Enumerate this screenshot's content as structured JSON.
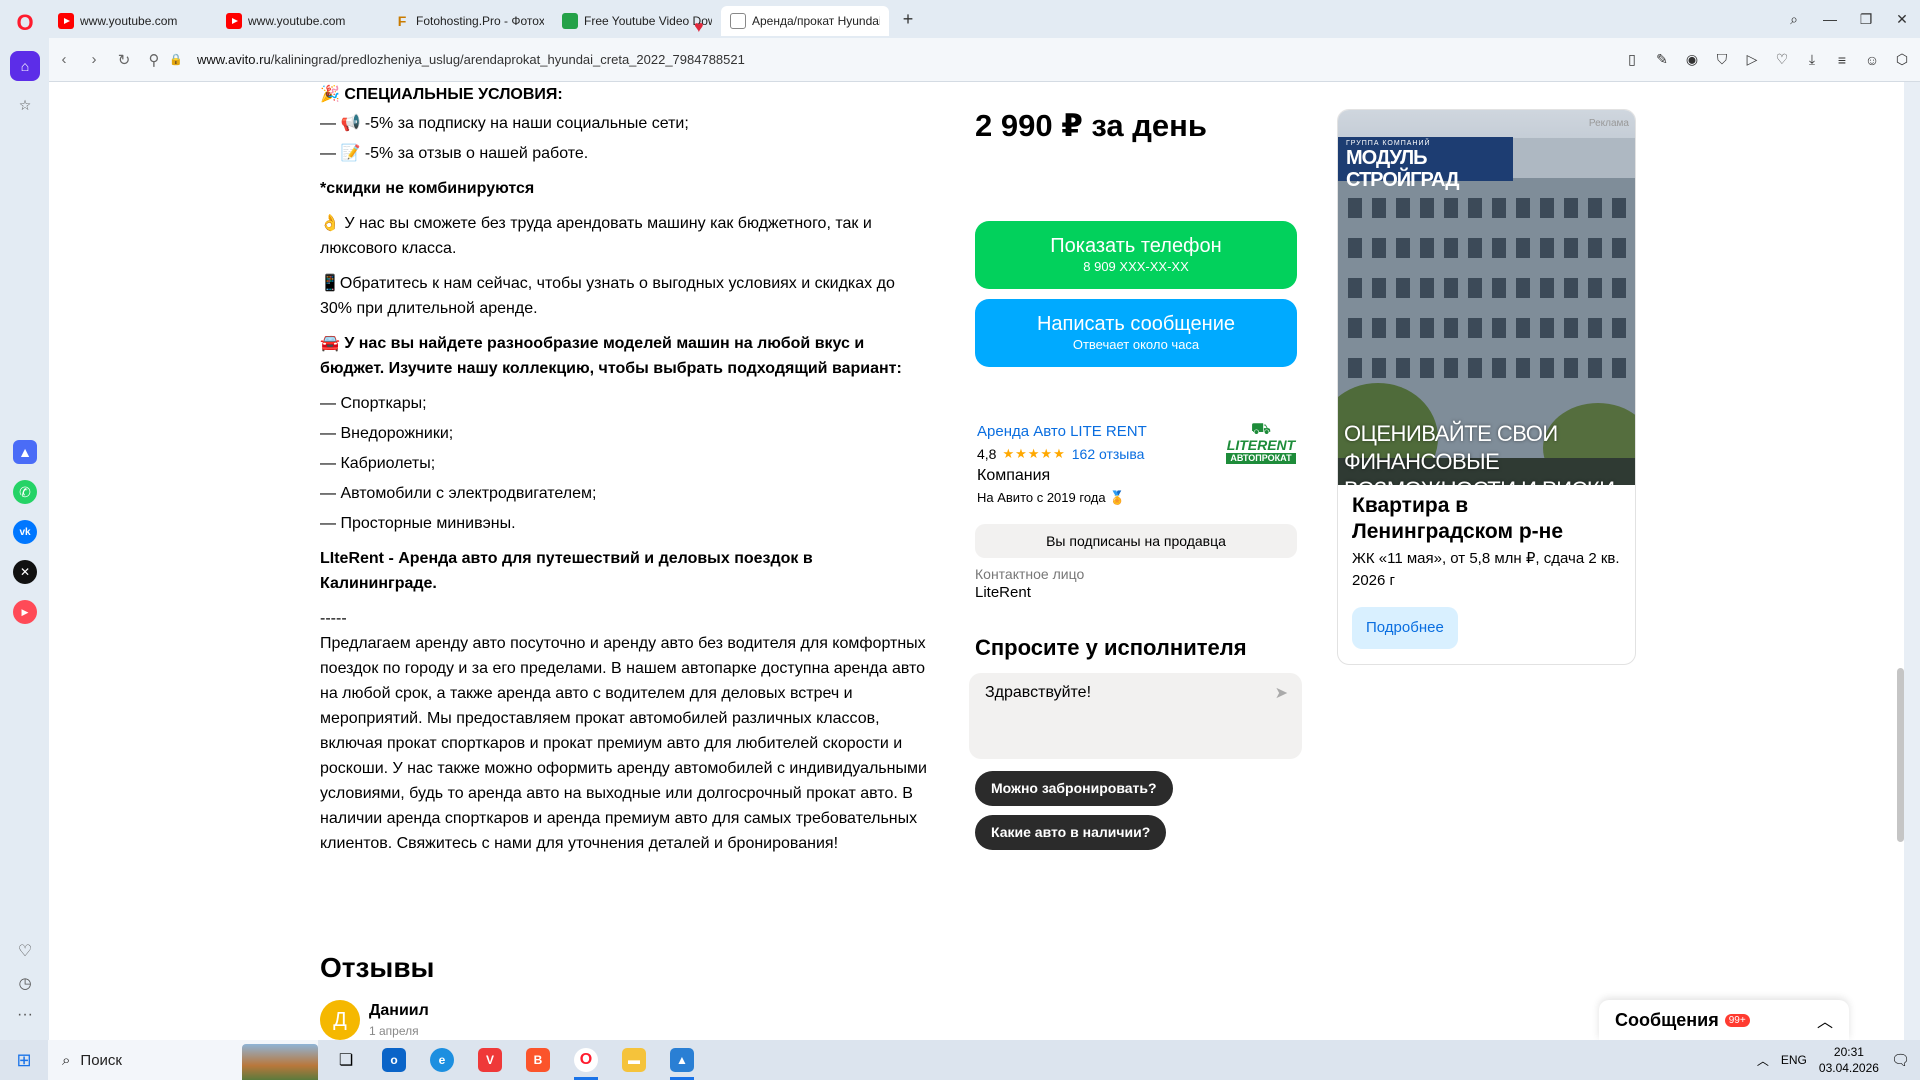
{
  "browser": {
    "tabs": [
      {
        "label": "www.youtube.com",
        "favicon": "youtube-icon"
      },
      {
        "label": "www.youtube.com",
        "favicon": "youtube-icon"
      },
      {
        "label": "Fotohosting.Pro - Фотохо",
        "favicon": "fotohosting-icon"
      },
      {
        "label": "Free Youtube Video Dow",
        "favicon": "download-icon"
      },
      {
        "label": "Аренда/прокат Hyundai C",
        "favicon": "avito-icon"
      }
    ],
    "new_tab": "+",
    "url_host": "www.avito.ru",
    "url_path": "/kaliningrad/predlozheniya_uslug/arendaprokat_hyundai_creta_2022_7984788521"
  },
  "description": {
    "special_title": "🎉 СПЕЦИАЛЬНЫЕ УСЛОВИЯ:",
    "special_1": "— 📢 -5% за подписку на наши социальные сети;",
    "special_2": "— 📝 -5% за отзыв о нашей работе.",
    "no_combine": "*скидки не комбинируются",
    "p1": "👌 У нас вы сможете без труда арендовать машину как бюджетного, так и люксового класса.",
    "p2": "📱Обратитесь к нам сейчас, чтобы узнать о выгодных условиях и скидках до 30% при длительной аренде.",
    "p3": "🚘 У нас вы найдете разнообразие моделей машин на любой вкус и бюджет. Изучите нашу коллекцию, чтобы выбрать подходящий вариант:",
    "list": [
      "— Спорткары;",
      "— Внедорожники;",
      "— Кабриолеты;",
      "— Автомобили с электродвигателем;",
      "— Просторные минивэны."
    ],
    "p4": "LIteRent - Аренда авто для путешествий и деловых поездок в Калининграде.",
    "divider": "-----",
    "p5": "Предлагаем аренду авто посуточно и аренду авто без водителя для комфортных поездок по городу и за его пределами. В нашем автопарке доступна аренда авто на любой срок, а также аренда авто с водителем для деловых встреч и мероприятий. Мы предоставляем прокат автомобилей различных классов, включая прокат спорткаров и прокат премиум авто для любителей скорости и роскоши. У нас также можно оформить аренду автомобилей с индивидуальными условиями, будь то аренда авто на выходные или долгосрочный прокат авто. В наличии аренда спорткаров и аренда премиум авто для самых требовательных клиентов. Свяжитесь с нами для уточнения деталей и бронирования!"
  },
  "reviews": {
    "title": "Отзывы",
    "first": {
      "initial": "Д",
      "name": "Даниил",
      "date": "1 апреля"
    }
  },
  "listing": {
    "price": "2 990 ₽ за день",
    "phone_btn": "Показать телефон",
    "phone_masked": "8 909 XXX-XX-XX",
    "msg_btn": "Написать сообщение",
    "msg_sub": "Отвечает около часа"
  },
  "seller": {
    "name": "Аренда Авто LITE RENT",
    "rating": "4,8",
    "stars": "★★★★★",
    "rating_value": 4.8,
    "reviews": "162 отзыва",
    "type": "Компания",
    "since": "На Авито с 2019 года 🏅",
    "logo_text": "LITERENT",
    "logo_sub": "АВТОПРОКАТ",
    "subscribed": "Вы подписаны на продавца",
    "contact_label": "Контактное лицо",
    "contact_name": "LiteRent"
  },
  "ask": {
    "title": "Спросите у исполнителя",
    "input_value": "Здравствуйте!",
    "chips": [
      "Можно забронировать?",
      "Какие авто в наличии?"
    ]
  },
  "ad": {
    "tag": "Реклама",
    "logo_small": "ГРУППА КОМПАНИЙ",
    "logo_main": "МОДУЛЬ СТРОЙГРАД",
    "slogan": "ОЦЕНИВАЙТЕ СВОИ ФИНАНСОВЫЕ ВОЗМОЖНОСТИ И РИСКИ",
    "title": "Квартира в Ленинградском р-не",
    "sub": "ЖК «11 мая», от 5,8 млн ₽, сдача 2 кв. 2026 г",
    "btn": "Подробнее"
  },
  "messages": {
    "label": "Сообщения",
    "badge": "99+"
  },
  "taskbar": {
    "search": "Поиск",
    "lang": "ENG",
    "time": "20:31",
    "date": "03.04.2026"
  },
  "colors": {
    "green": "#02d15c",
    "blue": "#00aaff",
    "link": "#0a6ee0",
    "opera": "#ff1b2d"
  }
}
